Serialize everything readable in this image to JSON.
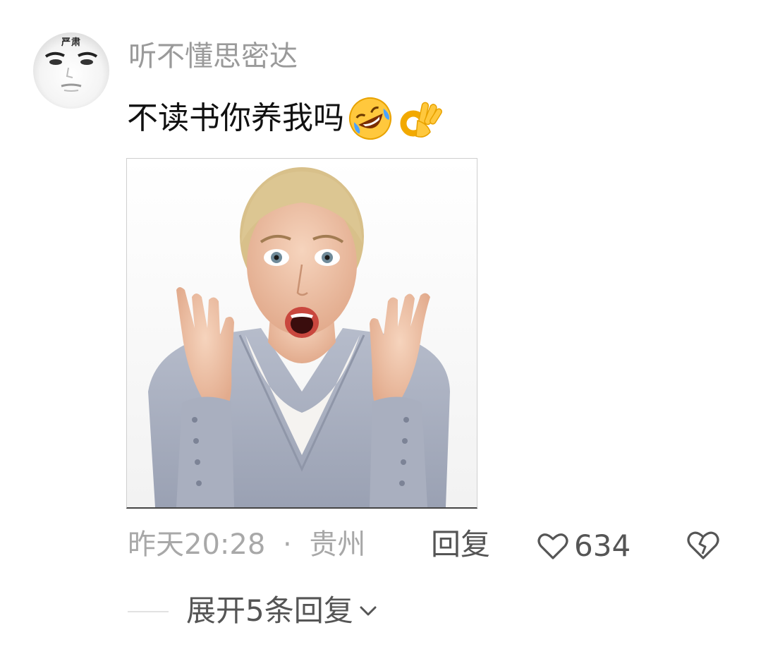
{
  "comment": {
    "avatar_badge": "严肃",
    "username": "听不懂思密达",
    "text": "不读书你养我吗",
    "emojis": [
      "rofl-emoji",
      "ok-hand-emoji"
    ],
    "image_icon": "shocked-woman-photo",
    "time": "昨天20:28",
    "separator": "·",
    "location": "贵州",
    "reply_label": "回复",
    "like_count": "634",
    "expand_label": "展开5条回复"
  },
  "colors": {
    "username": "#9a9a9a",
    "text": "#111111",
    "meta": "#a8a8a8",
    "action": "#555555"
  }
}
